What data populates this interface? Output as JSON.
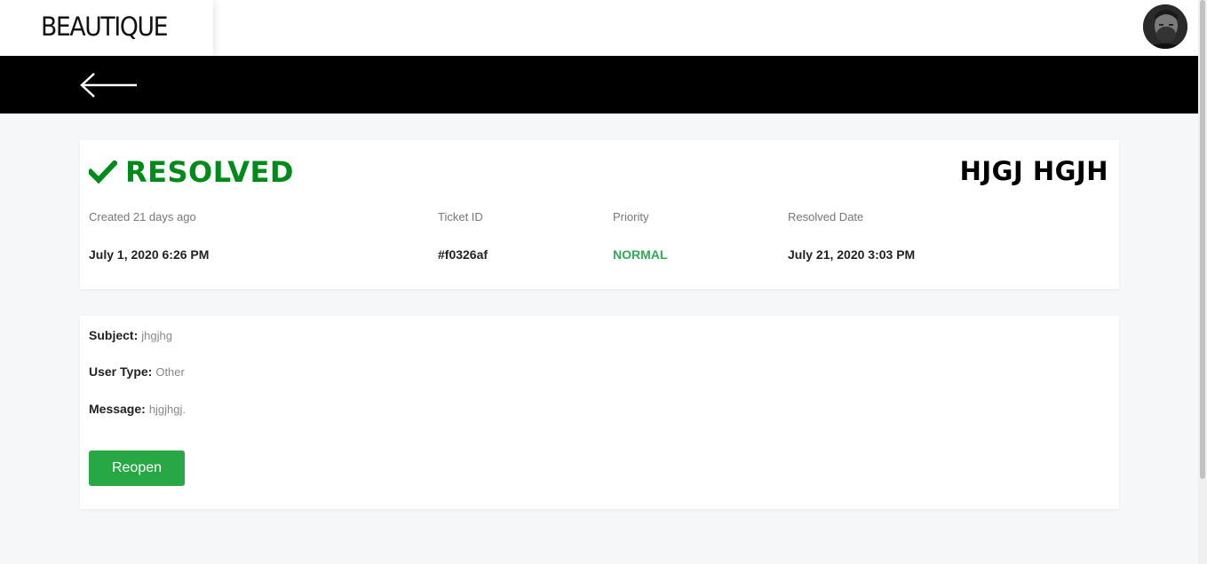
{
  "brand": {
    "logo_text": "BEAUTIQUE"
  },
  "header": {
    "back_icon": "arrow-left-icon",
    "avatar_icon": "user-avatar"
  },
  "ticket": {
    "status": "RESOLVED",
    "status_icon": "checkmark-icon",
    "status_color": "#008a1a",
    "title": "HJGJ HGJH",
    "meta": [
      {
        "label": "Created 21 days ago",
        "value": "July 1, 2020 6:26 PM"
      },
      {
        "label": "Ticket ID",
        "value": "#f0326af"
      },
      {
        "label": "Priority",
        "value": "NORMAL"
      },
      {
        "label": "Resolved Date",
        "value": "July 21, 2020 3:03 PM"
      }
    ],
    "priority_color": "#34a853"
  },
  "details": {
    "subject_label": "Subject:",
    "subject_value": "jhgjhg",
    "user_type_label": "User Type:",
    "user_type_value": "Other",
    "message_label": "Message:",
    "message_value": "hjgjhgj.",
    "reopen_label": "Reopen"
  }
}
